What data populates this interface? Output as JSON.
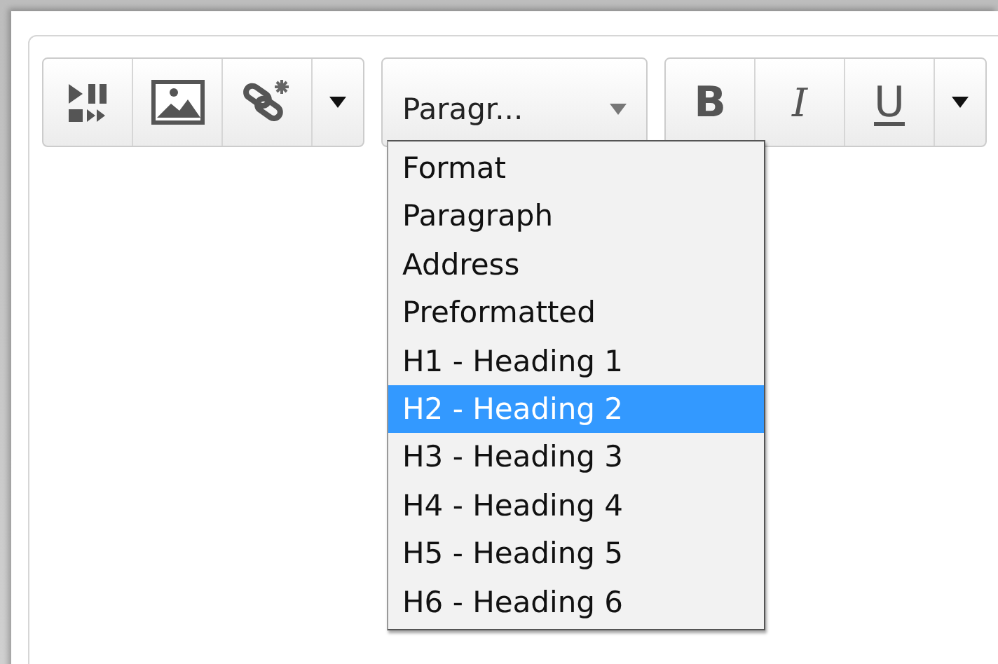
{
  "toolbar": {
    "format_select": {
      "value": "Paragr..."
    },
    "text_buttons": [
      {
        "label": "B",
        "kind": "bold"
      },
      {
        "label": "I",
        "kind": "italic"
      },
      {
        "label": "U",
        "kind": "underline"
      }
    ]
  },
  "format_menu": {
    "items": [
      {
        "label": "Format",
        "selected": false
      },
      {
        "label": "Paragraph",
        "selected": false
      },
      {
        "label": "Address",
        "selected": false
      },
      {
        "label": "Preformatted",
        "selected": false
      },
      {
        "label": "H1 - Heading 1",
        "selected": false
      },
      {
        "label": "H2 - Heading 2",
        "selected": true
      },
      {
        "label": "H3 - Heading 3",
        "selected": false
      },
      {
        "label": "H4 - Heading 4",
        "selected": false
      },
      {
        "label": "H5 - Heading 5",
        "selected": false
      },
      {
        "label": "H6 - Heading 6",
        "selected": false
      }
    ]
  }
}
